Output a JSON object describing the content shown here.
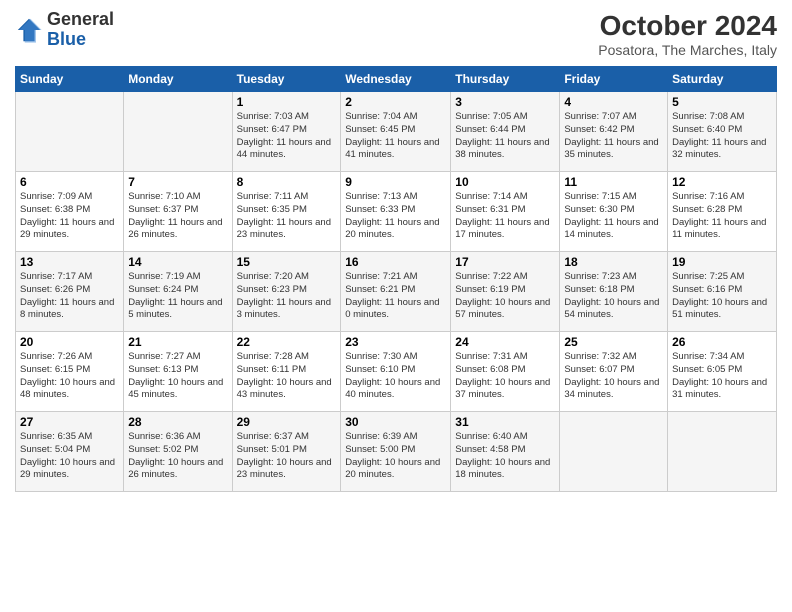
{
  "header": {
    "logo_line1": "General",
    "logo_line2": "Blue",
    "month": "October 2024",
    "location": "Posatora, The Marches, Italy"
  },
  "weekdays": [
    "Sunday",
    "Monday",
    "Tuesday",
    "Wednesday",
    "Thursday",
    "Friday",
    "Saturday"
  ],
  "weeks": [
    [
      {
        "day": "",
        "info": ""
      },
      {
        "day": "",
        "info": ""
      },
      {
        "day": "1",
        "info": "Sunrise: 7:03 AM\nSunset: 6:47 PM\nDaylight: 11 hours and 44 minutes."
      },
      {
        "day": "2",
        "info": "Sunrise: 7:04 AM\nSunset: 6:45 PM\nDaylight: 11 hours and 41 minutes."
      },
      {
        "day": "3",
        "info": "Sunrise: 7:05 AM\nSunset: 6:44 PM\nDaylight: 11 hours and 38 minutes."
      },
      {
        "day": "4",
        "info": "Sunrise: 7:07 AM\nSunset: 6:42 PM\nDaylight: 11 hours and 35 minutes."
      },
      {
        "day": "5",
        "info": "Sunrise: 7:08 AM\nSunset: 6:40 PM\nDaylight: 11 hours and 32 minutes."
      }
    ],
    [
      {
        "day": "6",
        "info": "Sunrise: 7:09 AM\nSunset: 6:38 PM\nDaylight: 11 hours and 29 minutes."
      },
      {
        "day": "7",
        "info": "Sunrise: 7:10 AM\nSunset: 6:37 PM\nDaylight: 11 hours and 26 minutes."
      },
      {
        "day": "8",
        "info": "Sunrise: 7:11 AM\nSunset: 6:35 PM\nDaylight: 11 hours and 23 minutes."
      },
      {
        "day": "9",
        "info": "Sunrise: 7:13 AM\nSunset: 6:33 PM\nDaylight: 11 hours and 20 minutes."
      },
      {
        "day": "10",
        "info": "Sunrise: 7:14 AM\nSunset: 6:31 PM\nDaylight: 11 hours and 17 minutes."
      },
      {
        "day": "11",
        "info": "Sunrise: 7:15 AM\nSunset: 6:30 PM\nDaylight: 11 hours and 14 minutes."
      },
      {
        "day": "12",
        "info": "Sunrise: 7:16 AM\nSunset: 6:28 PM\nDaylight: 11 hours and 11 minutes."
      }
    ],
    [
      {
        "day": "13",
        "info": "Sunrise: 7:17 AM\nSunset: 6:26 PM\nDaylight: 11 hours and 8 minutes."
      },
      {
        "day": "14",
        "info": "Sunrise: 7:19 AM\nSunset: 6:24 PM\nDaylight: 11 hours and 5 minutes."
      },
      {
        "day": "15",
        "info": "Sunrise: 7:20 AM\nSunset: 6:23 PM\nDaylight: 11 hours and 3 minutes."
      },
      {
        "day": "16",
        "info": "Sunrise: 7:21 AM\nSunset: 6:21 PM\nDaylight: 11 hours and 0 minutes."
      },
      {
        "day": "17",
        "info": "Sunrise: 7:22 AM\nSunset: 6:19 PM\nDaylight: 10 hours and 57 minutes."
      },
      {
        "day": "18",
        "info": "Sunrise: 7:23 AM\nSunset: 6:18 PM\nDaylight: 10 hours and 54 minutes."
      },
      {
        "day": "19",
        "info": "Sunrise: 7:25 AM\nSunset: 6:16 PM\nDaylight: 10 hours and 51 minutes."
      }
    ],
    [
      {
        "day": "20",
        "info": "Sunrise: 7:26 AM\nSunset: 6:15 PM\nDaylight: 10 hours and 48 minutes."
      },
      {
        "day": "21",
        "info": "Sunrise: 7:27 AM\nSunset: 6:13 PM\nDaylight: 10 hours and 45 minutes."
      },
      {
        "day": "22",
        "info": "Sunrise: 7:28 AM\nSunset: 6:11 PM\nDaylight: 10 hours and 43 minutes."
      },
      {
        "day": "23",
        "info": "Sunrise: 7:30 AM\nSunset: 6:10 PM\nDaylight: 10 hours and 40 minutes."
      },
      {
        "day": "24",
        "info": "Sunrise: 7:31 AM\nSunset: 6:08 PM\nDaylight: 10 hours and 37 minutes."
      },
      {
        "day": "25",
        "info": "Sunrise: 7:32 AM\nSunset: 6:07 PM\nDaylight: 10 hours and 34 minutes."
      },
      {
        "day": "26",
        "info": "Sunrise: 7:34 AM\nSunset: 6:05 PM\nDaylight: 10 hours and 31 minutes."
      }
    ],
    [
      {
        "day": "27",
        "info": "Sunrise: 6:35 AM\nSunset: 5:04 PM\nDaylight: 10 hours and 29 minutes."
      },
      {
        "day": "28",
        "info": "Sunrise: 6:36 AM\nSunset: 5:02 PM\nDaylight: 10 hours and 26 minutes."
      },
      {
        "day": "29",
        "info": "Sunrise: 6:37 AM\nSunset: 5:01 PM\nDaylight: 10 hours and 23 minutes."
      },
      {
        "day": "30",
        "info": "Sunrise: 6:39 AM\nSunset: 5:00 PM\nDaylight: 10 hours and 20 minutes."
      },
      {
        "day": "31",
        "info": "Sunrise: 6:40 AM\nSunset: 4:58 PM\nDaylight: 10 hours and 18 minutes."
      },
      {
        "day": "",
        "info": ""
      },
      {
        "day": "",
        "info": ""
      }
    ]
  ]
}
